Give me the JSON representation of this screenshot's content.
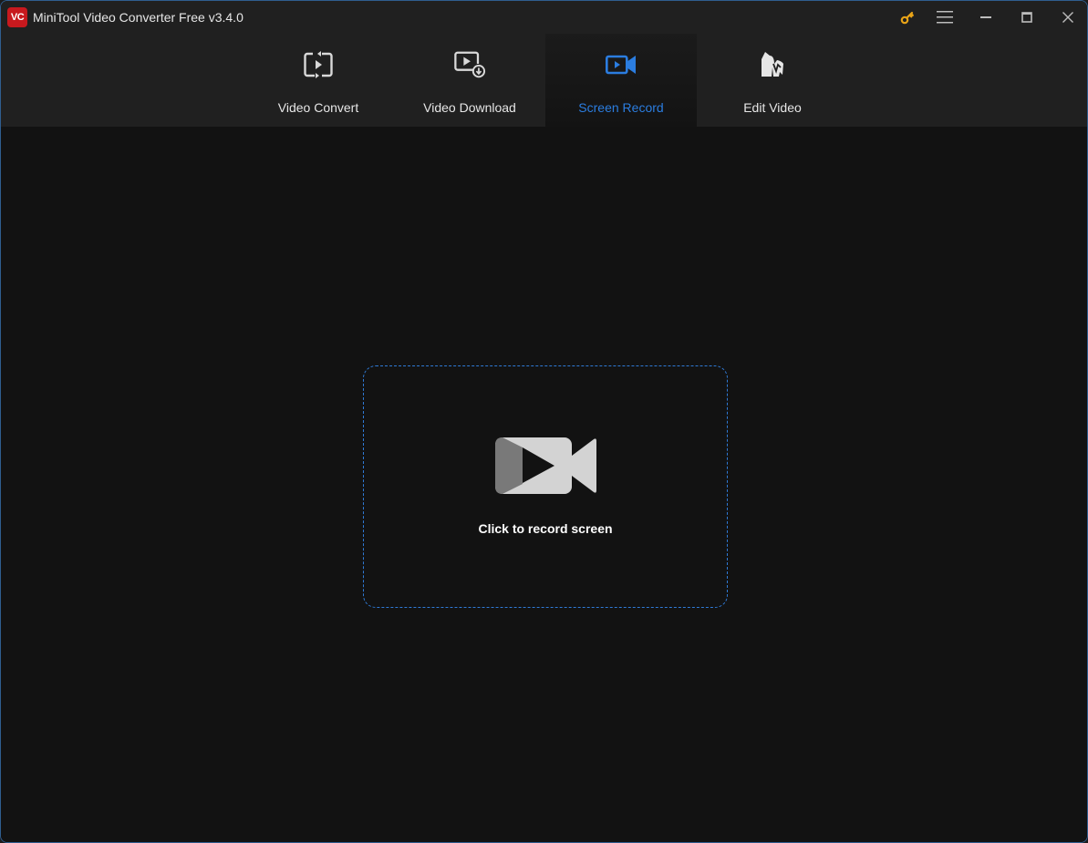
{
  "app": {
    "logo_text": "VC",
    "title": "MiniTool Video Converter Free v3.4.0"
  },
  "titlebar": {
    "controls": [
      {
        "name": "key-icon",
        "label": "Upgrade / Register"
      },
      {
        "name": "menu-icon",
        "label": "Menu"
      },
      {
        "name": "minimize-icon",
        "label": "Minimize"
      },
      {
        "name": "maximize-icon",
        "label": "Maximize"
      },
      {
        "name": "close-icon",
        "label": "Close"
      }
    ],
    "key_color": "#e8a317"
  },
  "tabs": [
    {
      "id": "video-convert",
      "label": "Video Convert",
      "icon": "convert-icon",
      "active": false
    },
    {
      "id": "video-download",
      "label": "Video Download",
      "icon": "download-icon",
      "active": false
    },
    {
      "id": "screen-record",
      "label": "Screen Record",
      "icon": "camera-icon",
      "active": true
    },
    {
      "id": "edit-video",
      "label": "Edit Video",
      "icon": "movie-maker-icon",
      "active": false
    }
  ],
  "accent_color": "#2b7de0",
  "record_panel": {
    "icon": "video-camera-icon",
    "label": "Click to record screen"
  }
}
